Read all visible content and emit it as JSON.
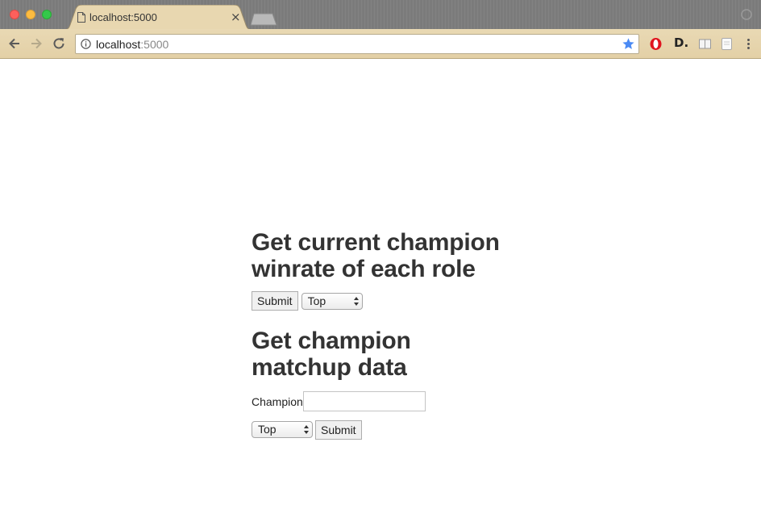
{
  "browser": {
    "tab_title": "localhost:5000",
    "tab_close_glyph": "×",
    "url_host": "localhost",
    "url_port": ":5000",
    "icons": [
      "back-arrow-icon",
      "forward-arrow-icon",
      "reload-icon",
      "info-icon",
      "star-icon",
      "opera-icon",
      "d-extension-icon",
      "reader-icon",
      "note-icon",
      "menu-icon"
    ],
    "star_color": "#4a8af4",
    "toolbar_color": "#e6d5ad",
    "ext_d_label": "D."
  },
  "page": {
    "section1": {
      "heading_line1": "Get current champion",
      "heading_line2": "winrate of each role",
      "submit_label": "Submit",
      "role_selected": "Top"
    },
    "section2": {
      "heading_line1": "Get champion",
      "heading_line2": "matchup data",
      "champion_label": "Champion",
      "champion_value": "",
      "role_selected": "Top",
      "submit_label": "Submit"
    }
  }
}
